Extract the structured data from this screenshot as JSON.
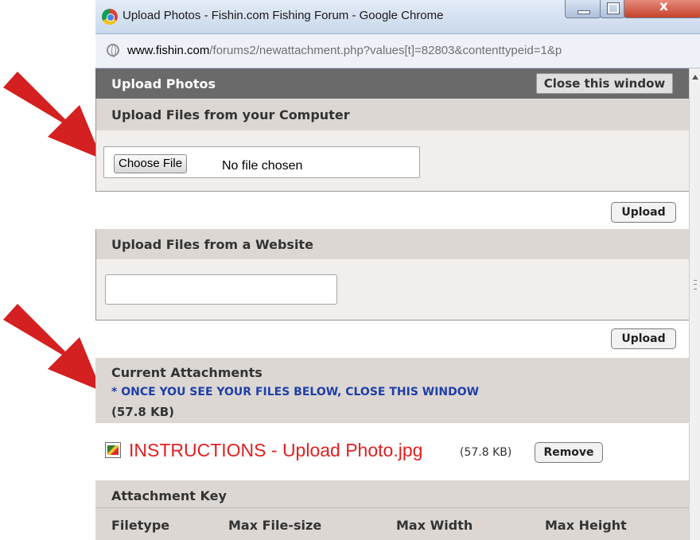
{
  "window": {
    "title": "Upload Photos - Fishin.com Fishing Forum - Google Chrome",
    "controls": {
      "close": "x"
    }
  },
  "address_bar": {
    "host": "www.fishin.com",
    "path": "/forums2/newattachment.php?values[t]=82803&contenttypeid=1&p"
  },
  "page": {
    "header_title": "Upload Photos",
    "close_window_label": "Close this window",
    "computer_section": {
      "title": "Upload Files from your Computer",
      "choose_file_label": "Choose File",
      "no_file_text": "No file chosen",
      "upload_label": "Upload"
    },
    "website_section": {
      "title": "Upload Files from a Website",
      "url_value": "",
      "upload_label": "Upload"
    },
    "attachments": {
      "title": "Current Attachments",
      "notice": "* ONCE YOU SEE YOUR FILES BELOW, CLOSE THIS WINDOW",
      "total_size": "(57.8 KB)",
      "items": [
        {
          "name": "INSTRUCTIONS - Upload Photo.jpg",
          "size": "(57.8 KB)",
          "remove_label": "Remove"
        }
      ]
    },
    "attachment_key": {
      "title": "Attachment Key",
      "columns": [
        "Filetype",
        "Max File-size",
        "Max Width",
        "Max Height"
      ]
    }
  },
  "colors": {
    "annotation_arrow": "#d42020",
    "header_bg": "#6a6a6a",
    "section_head_bg": "#dcd7d3",
    "section_body_bg": "#f1eeeb",
    "notice_text": "#1f3fa8",
    "file_link": "#e02020"
  }
}
